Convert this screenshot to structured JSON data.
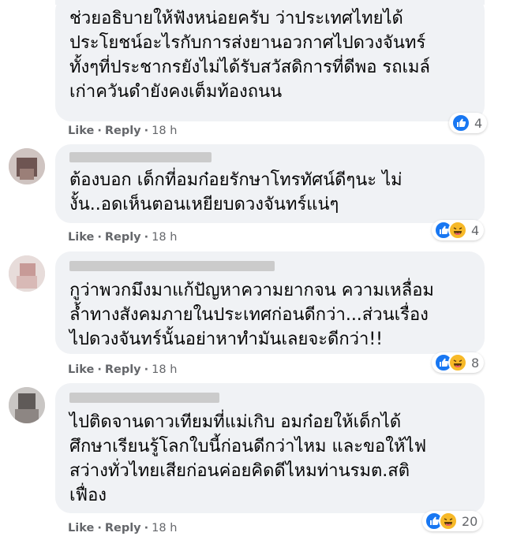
{
  "comments": [
    {
      "text": "ช่วยอธิบายให้ฟังหน่อยครับ ว่าประเทศไทยได้\nประโยชน์อะไรกับการส่งยานอวกาศไปดวงจันทร์\nทั้งๆที่ประชากรยังไม่ได้รับสวัสดิการที่ดีพอ รถเมล์\nเก่าควันดำยังคงเต็มท้องถนน",
      "like": "Like",
      "reply": "Reply",
      "time": "18 h",
      "reaction_count": "4",
      "reactions": [
        "like"
      ]
    },
    {
      "text": "ต้องบอก เด็กที่อมก๋อยรักษาโทรทัศน์ดีๆนะ ไม่\nงั้น..อดเห็นตอนเหยียบดวงจันทร์แน่ๆ",
      "like": "Like",
      "reply": "Reply",
      "time": "18 h",
      "reaction_count": "4",
      "reactions": [
        "like",
        "haha"
      ]
    },
    {
      "text": "กูว่าพวกมึงมาแก้ปัญหาความยากจน ความเหลื่อม\nล้ำทางสังคมภายในประเทศก่อนดีกว่า...ส่วนเรื่อง\nไปดวงจันทร์นั้นอย่าหาทำมันเลยจะดีกว่า!!",
      "like": "Like",
      "reply": "Reply",
      "time": "18 h",
      "reaction_count": "8",
      "reactions": [
        "like",
        "haha"
      ]
    },
    {
      "text": "ไปติดจานดาวเทียมที่แม่เกิบ อมก๋อยให้เด็กได้\nศึกษาเรียนรู้โลกใบนี้ก่อนดีกว่าไหม และขอให้ไฟ\nสว่างทั่วไทยเสียก่อนค่อยคิดดีไหมท่านรมต.สติ\nเฟื่อง",
      "like": "Like",
      "reply": "Reply",
      "time": "18 h",
      "reaction_count": "20",
      "reactions": [
        "like",
        "haha"
      ]
    }
  ],
  "colors": {
    "bubble": "#f0f2f5",
    "text": "#050505",
    "meta": "#65676b",
    "like": "#1877f2",
    "haha": "#f7b928"
  }
}
